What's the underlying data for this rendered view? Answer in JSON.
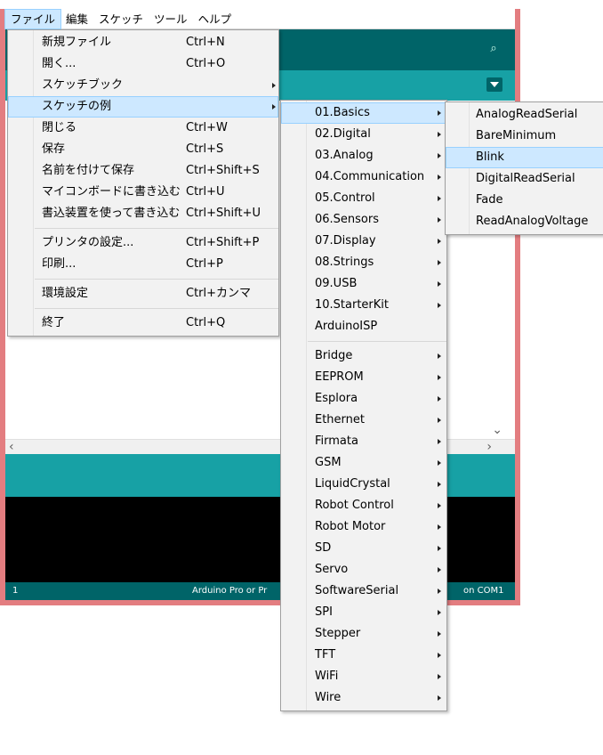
{
  "menubar": [
    "ファイル",
    "編集",
    "スケッチ",
    "ツール",
    "ヘルプ"
  ],
  "file_menu": {
    "items": [
      {
        "label": "新規ファイル",
        "shortcut": "Ctrl+N"
      },
      {
        "label": "開く...",
        "shortcut": "Ctrl+O"
      },
      {
        "label": "スケッチブック",
        "shortcut": "",
        "submenu": true
      },
      {
        "label": "スケッチの例",
        "shortcut": "",
        "submenu": true,
        "highlighted": true
      },
      {
        "label": "閉じる",
        "shortcut": "Ctrl+W"
      },
      {
        "label": "保存",
        "shortcut": "Ctrl+S"
      },
      {
        "label": "名前を付けて保存",
        "shortcut": "Ctrl+Shift+S"
      },
      {
        "label": "マイコンボードに書き込む",
        "shortcut": "Ctrl+U"
      },
      {
        "label": "書込装置を使って書き込む",
        "shortcut": "Ctrl+Shift+U"
      },
      {
        "separator": true
      },
      {
        "label": "プリンタの設定...",
        "shortcut": "Ctrl+Shift+P"
      },
      {
        "label": "印刷...",
        "shortcut": "Ctrl+P"
      },
      {
        "separator": true
      },
      {
        "label": "環境設定",
        "shortcut": "Ctrl+カンマ"
      },
      {
        "separator": true
      },
      {
        "label": "終了",
        "shortcut": "Ctrl+Q"
      }
    ]
  },
  "examples_menu": {
    "items": [
      {
        "label": "01.Basics",
        "submenu": true,
        "highlighted": true
      },
      {
        "label": "02.Digital",
        "submenu": true
      },
      {
        "label": "03.Analog",
        "submenu": true
      },
      {
        "label": "04.Communication",
        "submenu": true
      },
      {
        "label": "05.Control",
        "submenu": true
      },
      {
        "label": "06.Sensors",
        "submenu": true
      },
      {
        "label": "07.Display",
        "submenu": true
      },
      {
        "label": "08.Strings",
        "submenu": true
      },
      {
        "label": "09.USB",
        "submenu": true
      },
      {
        "label": "10.StarterKit",
        "submenu": true
      },
      {
        "label": "ArduinoISP",
        "submenu": false
      },
      {
        "separator": true
      },
      {
        "label": "Bridge",
        "submenu": true
      },
      {
        "label": "EEPROM",
        "submenu": true
      },
      {
        "label": "Esplora",
        "submenu": true
      },
      {
        "label": "Ethernet",
        "submenu": true
      },
      {
        "label": "Firmata",
        "submenu": true
      },
      {
        "label": "GSM",
        "submenu": true
      },
      {
        "label": "LiquidCrystal",
        "submenu": true
      },
      {
        "label": "Robot Control",
        "submenu": true
      },
      {
        "label": "Robot Motor",
        "submenu": true
      },
      {
        "label": "SD",
        "submenu": true
      },
      {
        "label": "Servo",
        "submenu": true
      },
      {
        "label": "SoftwareSerial",
        "submenu": true
      },
      {
        "label": "SPI",
        "submenu": true
      },
      {
        "label": "Stepper",
        "submenu": true
      },
      {
        "label": "TFT",
        "submenu": true
      },
      {
        "label": "WiFi",
        "submenu": true
      },
      {
        "label": "Wire",
        "submenu": true
      }
    ]
  },
  "basics_menu": {
    "items": [
      {
        "label": "AnalogReadSerial"
      },
      {
        "label": "BareMinimum"
      },
      {
        "label": "Blink",
        "highlighted": true
      },
      {
        "label": "DigitalReadSerial"
      },
      {
        "label": "Fade"
      },
      {
        "label": "ReadAnalogVoltage"
      }
    ]
  },
  "ide": {
    "footer_line": "1",
    "footer_board": "Arduino Pro or Pr",
    "footer_port": "on COM1",
    "colors": {
      "toolbar": "#006468",
      "tabs": "#17a1a5",
      "window_border": "#e37d80",
      "console": "#000000"
    }
  }
}
